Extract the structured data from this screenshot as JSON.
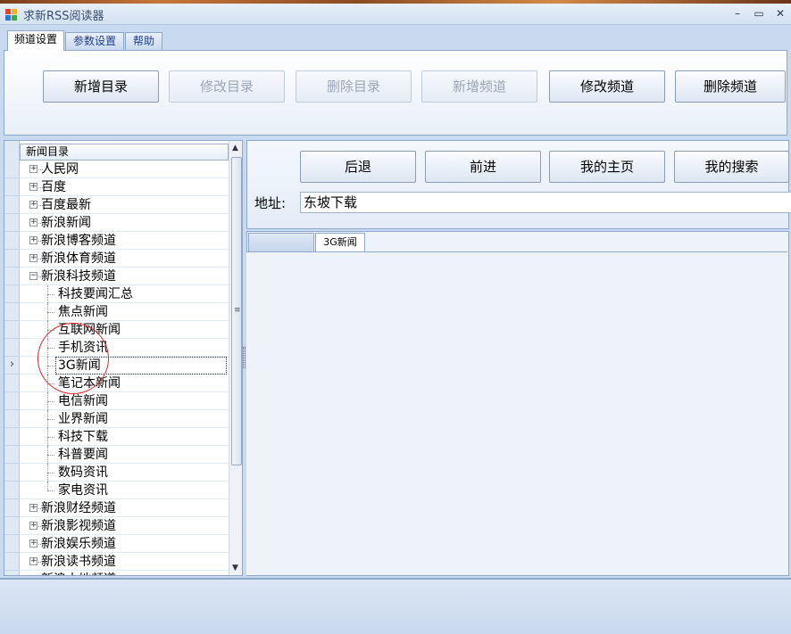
{
  "window": {
    "title": "求新RSS阅读器",
    "min": "–",
    "max": "▭",
    "close": "✕"
  },
  "tabs": [
    "频道设置",
    "参数设置",
    "帮助"
  ],
  "toolbar": {
    "new_folder": "新增目录",
    "edit_folder": "修改目录",
    "delete_folder": "删除目录",
    "new_channel": "新增频道",
    "edit_channel": "修改频道",
    "delete_channel": "删除频道"
  },
  "tree": {
    "header": "新闻目录",
    "items": [
      "人民网",
      "百度",
      "百度最新",
      "新浪新闻",
      "新浪博客频道",
      "新浪体育频道",
      "新浪科技频道",
      "科技要闻汇总",
      "焦点新闻",
      "互联网新闻",
      "手机资讯",
      "3G新闻",
      "笔记本新闻",
      "电信新闻",
      "业界新闻",
      "科技下载",
      "科普要闻",
      "数码资讯",
      "家电资讯",
      "新浪财经频道",
      "新浪影视频道",
      "新浪娱乐频道",
      "新浪读书频道",
      "新浪土地频道"
    ]
  },
  "nav": {
    "back": "后退",
    "forward": "前进",
    "home": "我的主页",
    "search": "我的搜索"
  },
  "address": {
    "label": "地址:",
    "value": "东坡下载"
  },
  "content_tabs": [
    "",
    "3G新闻"
  ],
  "colors": {
    "accent": "#8ea8cc",
    "annotation": "#d9282b"
  }
}
